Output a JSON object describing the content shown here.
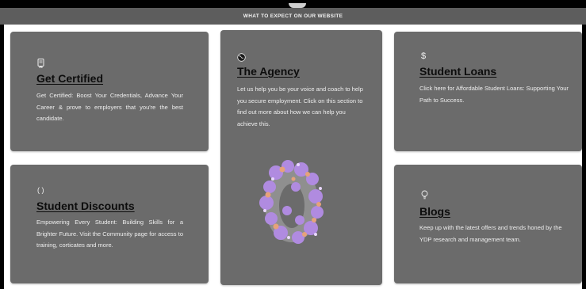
{
  "header": {
    "title": "WHAT TO EXPECT ON OUR WEBSITE"
  },
  "cards": {
    "get_certified": {
      "icon": "certificate-icon",
      "title": "Get Certified",
      "description": "Get Certified: Boost Your Credentials, Advance Your Career & prove to employers that you're the best candidate."
    },
    "the_agency": {
      "icon": "globe-icon",
      "title": "The Agency",
      "description": "Let us help you be your voice and coach to help you secure employment. Click on this section to find out more about how we can help you achieve this."
    },
    "student_loans": {
      "icon": "dollar-icon",
      "title": "Student Loans",
      "description": "Click here for Affordable Student Loans: Supporting Your Path to Success."
    },
    "student_discounts": {
      "icon": "discount-icon",
      "title": "Student Discounts",
      "description": "Empowering Every Student: Building Skills for a Brighter Future. Visit the Community page for access to training, corticates and more."
    },
    "blogs": {
      "icon": "lightbulb-icon",
      "title": "Blogs",
      "description": "Keep up with the latest offers and trends honed by the YDP research and management team."
    }
  },
  "colors": {
    "card_bg": "#6b6b6b",
    "header_bg": "#5d5d5d",
    "panel_bg": "#ffffff",
    "title_text": "#0d0d0d"
  }
}
